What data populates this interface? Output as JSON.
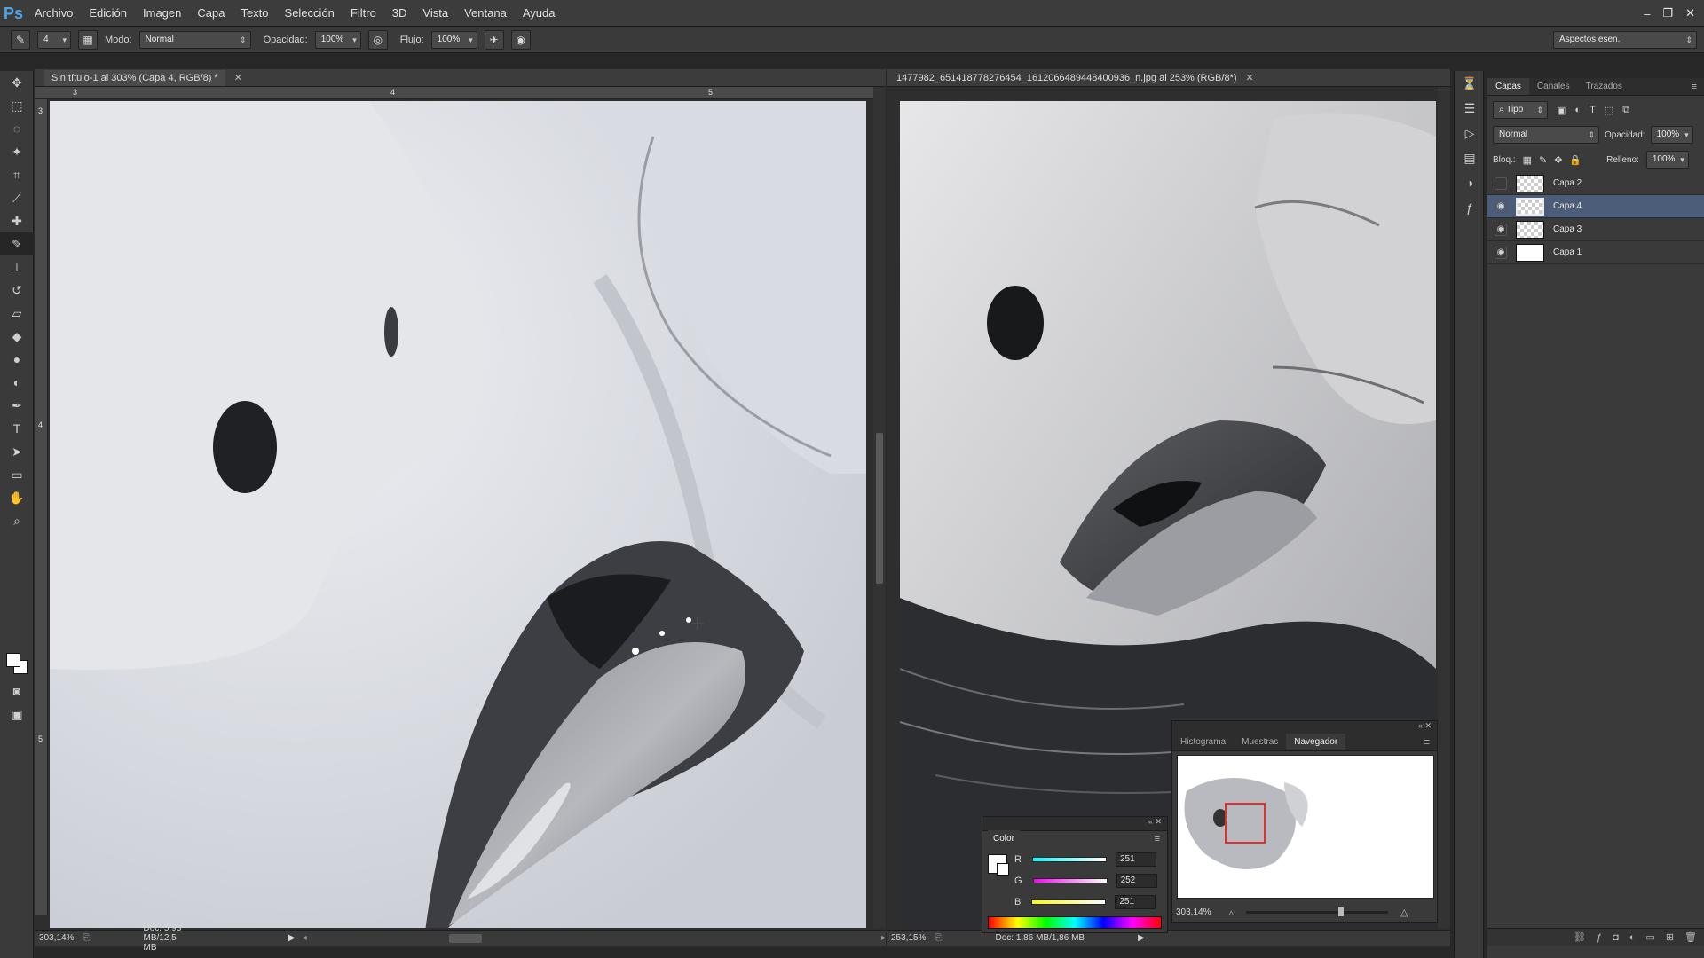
{
  "app": {
    "logo": "Ps",
    "menu": [
      "Archivo",
      "Edición",
      "Imagen",
      "Capa",
      "Texto",
      "Selección",
      "Filtro",
      "3D",
      "Vista",
      "Ventana",
      "Ayuda"
    ],
    "window_controls": [
      "–",
      "❐",
      "✕"
    ]
  },
  "options": {
    "brush_size": "4",
    "mode_label": "Modo:",
    "mode_value": "Normal",
    "opacity_label": "Opacidad:",
    "opacity_value": "100%",
    "flow_label": "Flujo:",
    "flow_value": "100%",
    "workspace": "Aspectos esen."
  },
  "doc_left": {
    "title": "Sin título-1 al 303% (Capa 4, RGB/8) *",
    "ruler_h": [
      "3",
      "4",
      "5"
    ],
    "ruler_v": [
      "3",
      "4",
      "5"
    ],
    "zoom": "303,14%",
    "doc_info": "Doc: 5,93 MB/12,5 MB"
  },
  "doc_right": {
    "title": "1477982_651418778276454_1612066489448400936_n.jpg al 253% (RGB/8*)",
    "zoom": "253,15%",
    "doc_info": "Doc: 1,86 MB/1,86 MB"
  },
  "layers_panel": {
    "tabs": [
      "Capas",
      "Canales",
      "Trazados"
    ],
    "active_tab": "Capas",
    "kind_filter": "Tipo",
    "blend_mode": "Normal",
    "opacity_label": "Opacidad:",
    "opacity_value": "100%",
    "lock_label": "Bloq.:",
    "fill_label": "Relleno:",
    "fill_value": "100%",
    "layers": [
      {
        "name": "Capa 2",
        "visible": false,
        "selected": false
      },
      {
        "name": "Capa 4",
        "visible": true,
        "selected": true
      },
      {
        "name": "Capa 3",
        "visible": true,
        "selected": false
      },
      {
        "name": "Capa 1",
        "visible": true,
        "selected": false
      }
    ]
  },
  "navigator_panel": {
    "tabs": [
      "Histograma",
      "Muestras",
      "Navegador"
    ],
    "active_tab": "Navegador",
    "zoom": "303,14%"
  },
  "color_panel": {
    "title": "Color",
    "channels": [
      {
        "label": "R",
        "value": "251"
      },
      {
        "label": "G",
        "value": "252"
      },
      {
        "label": "B",
        "value": "251"
      }
    ],
    "foreground": "#fbfcfb"
  },
  "colors": {
    "selection_highlight": "#4b5d78",
    "navigator_frame": "#e03030"
  }
}
